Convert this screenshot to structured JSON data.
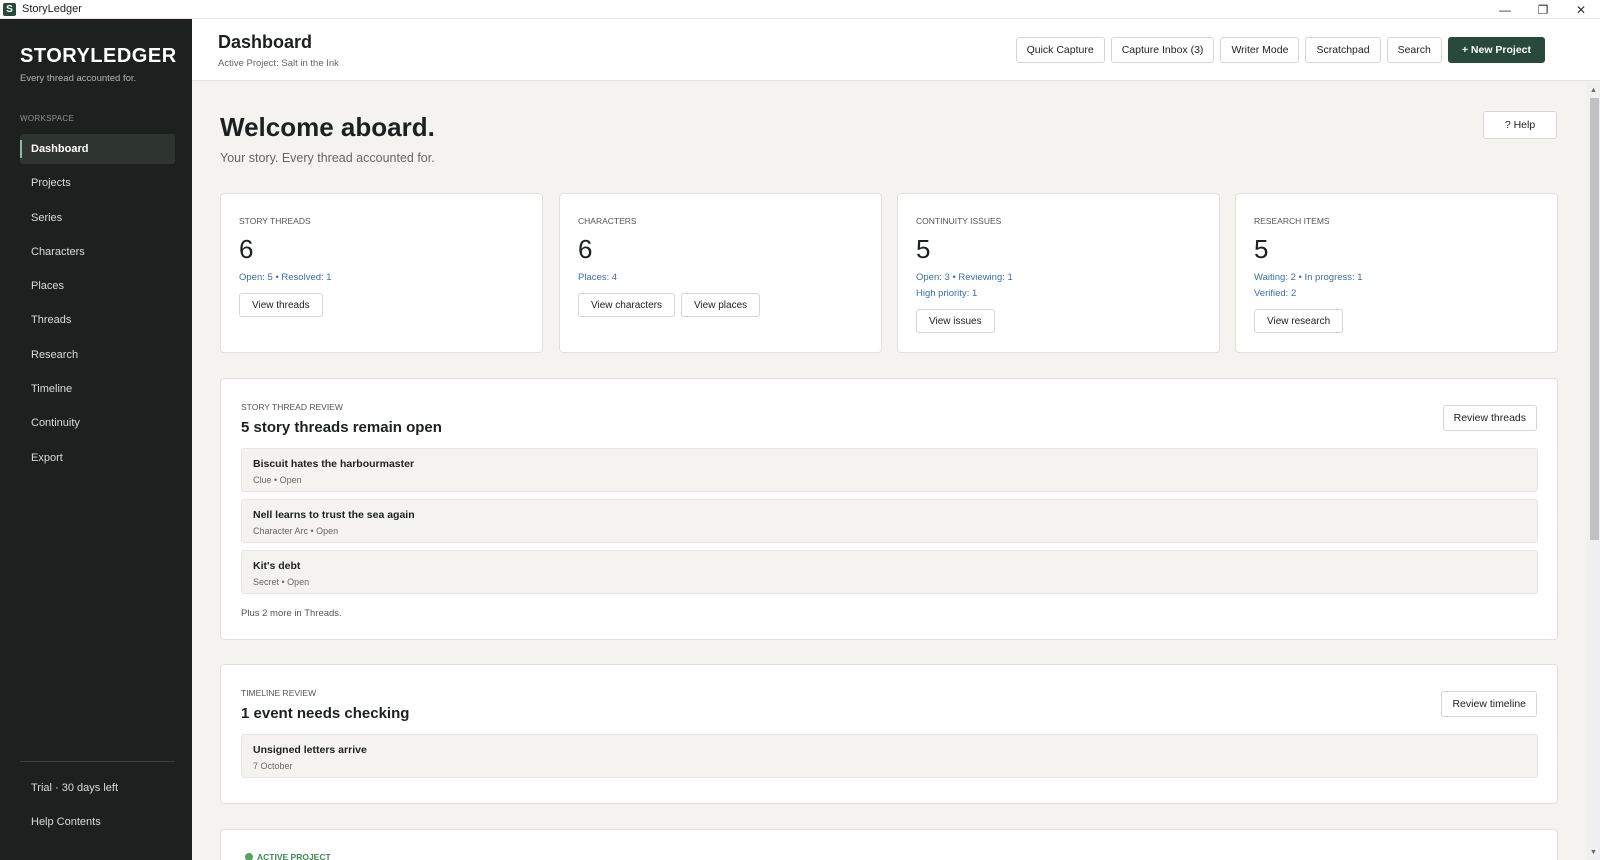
{
  "window": {
    "title": "StoryLedger",
    "icon_letter": "S",
    "controls": [
      "minimize-icon",
      "restore-icon",
      "close-icon"
    ]
  },
  "sidebar": {
    "brand": "STORYLEDGER",
    "tagline": "Every thread accounted for.",
    "section_label": "WORKSPACE",
    "items": [
      {
        "label": "Dashboard",
        "active": true
      },
      {
        "label": "Projects"
      },
      {
        "label": "Series"
      },
      {
        "label": "Characters"
      },
      {
        "label": "Places"
      },
      {
        "label": "Threads"
      },
      {
        "label": "Research"
      },
      {
        "label": "Timeline"
      },
      {
        "label": "Continuity"
      },
      {
        "label": "Export"
      }
    ],
    "trial": "Trial · 30 days left",
    "help_contents": "Help Contents"
  },
  "header": {
    "title": "Dashboard",
    "subtitle": "Active Project: Salt in the Ink",
    "actions": {
      "quick_capture": "Quick Capture",
      "capture_inbox": "Capture Inbox (3)",
      "writer_mode": "Writer Mode",
      "scratchpad": "Scratchpad",
      "search": "Search",
      "new_project": "+ New Project"
    }
  },
  "main": {
    "welcome": "Welcome aboard.",
    "welcome_sub": "Your story. Every thread accounted for.",
    "help_button": "? Help",
    "stats": {
      "threads": {
        "label": "STORY THREADS",
        "value": "6",
        "meta1": "Open: 5  •  Resolved: 1",
        "button": "View threads"
      },
      "characters": {
        "label": "CHARACTERS",
        "value": "6",
        "meta1": "Places: 4",
        "button1": "View characters",
        "button2": "View places"
      },
      "continuity": {
        "label": "CONTINUITY ISSUES",
        "value": "5",
        "meta1": "Open: 3  •  Reviewing: 1",
        "meta2": "High priority: 1",
        "button": "View issues"
      },
      "research": {
        "label": "RESEARCH ITEMS",
        "value": "5",
        "meta1": "Waiting: 2  •  In progress: 1",
        "meta2": "Verified: 2",
        "button": "View research"
      }
    },
    "thread_review": {
      "label": "STORY THREAD REVIEW",
      "title": "5 story threads remain open",
      "button": "Review threads",
      "rows": [
        {
          "title": "Biscuit hates the harbourmaster",
          "meta": "Clue  •  Open"
        },
        {
          "title": "Nell learns to trust the sea again",
          "meta": "Character Arc  •  Open"
        },
        {
          "title": "Kit's debt",
          "meta": "Secret  •  Open"
        }
      ],
      "footer": "Plus 2 more in Threads."
    },
    "timeline_review": {
      "label": "TIMELINE REVIEW",
      "title": "1 event needs checking",
      "button": "Review timeline",
      "rows": [
        {
          "title": "Unsigned letters arrive",
          "meta": "7 October"
        }
      ]
    },
    "active_project": {
      "label": "ACTIVE PROJECT",
      "status_color": "#52a45f"
    }
  },
  "colors": {
    "sidebar_bg": "#1c211f",
    "accent": "#274a3c",
    "link_blue": "#3b6ea8",
    "page_bg": "#f4f3ef"
  }
}
